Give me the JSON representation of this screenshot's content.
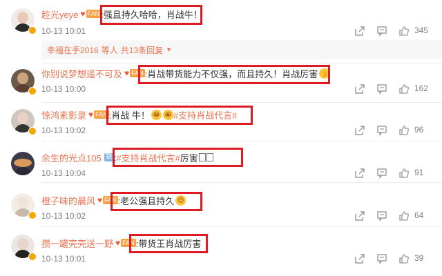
{
  "comments": [
    {
      "user": "趁光yeye",
      "badge": "FAN",
      "message": ":强且持久哈哈，肖战牛！",
      "time": "10-13 10:01",
      "likes": "345",
      "avatar_colors": [
        "#e9c9b8",
        "#2b2b2b"
      ]
    },
    {
      "user": "你别说梦想遥不可及",
      "badge": "FAN",
      "message": ":肖战带货能力不仅强，而且持久！肖战厉害",
      "time": "10-13 10:00",
      "likes": "162",
      "avatar_colors": [
        "#c9a47c",
        "#5a4030"
      ]
    },
    {
      "user": "惊鸿素影录",
      "badge": "FAN",
      "message_pre": ":肖战 牛！",
      "topic": "#支持肖战代言#",
      "time": "10-13 10:02",
      "likes": "96",
      "avatar_colors": [
        "#e8d2c8",
        "#333333"
      ]
    },
    {
      "user": "余生的光点105",
      "badge": "铁",
      "message_topic": "#支持肖战代言#",
      "message_post": " 厉害",
      "time": "10-13 10:04",
      "likes": "91",
      "avatar_colors": [
        "#d89a5a",
        "#3a3a4a"
      ]
    },
    {
      "user": "橙子味的晨风",
      "badge": "FAN",
      "message": ":老公强且持久",
      "time": "10-13 10:02",
      "likes": "64",
      "avatar_colors": [
        "#f0e4d8",
        "#c8b8a8"
      ]
    },
    {
      "user": "攒一罐壳壳送一野",
      "badge": "FAN",
      "message": ":带货王肖战厉害",
      "time": "10-13 10:01",
      "likes": "39",
      "avatar_colors": [
        "#e6d6cc",
        "#222222"
      ]
    }
  ],
  "replies_bar": {
    "who": "幸福在手2016",
    "text": "等人",
    "count": "共13条回复"
  },
  "icons": [
    "share-icon",
    "comment-icon",
    "like-icon"
  ],
  "accent_color": "#eb7350",
  "highlight_color": "#e01a22"
}
